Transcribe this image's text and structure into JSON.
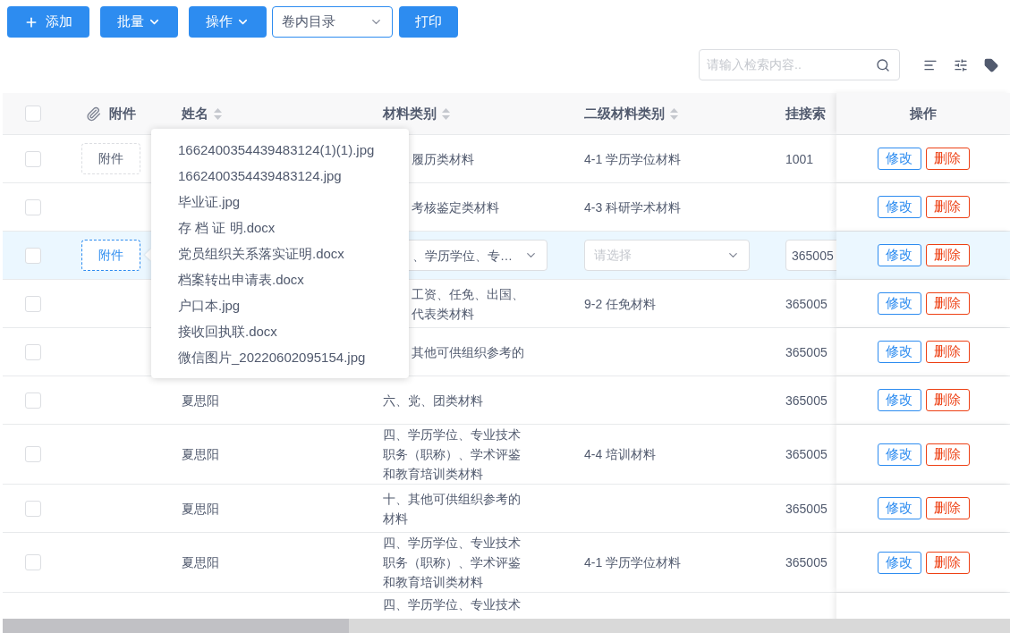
{
  "toolbar": {
    "buttons": [
      {
        "kind": "add",
        "label": "添加"
      },
      {
        "kind": "dropdown",
        "label": "批量"
      },
      {
        "kind": "dropdown",
        "label": "操作"
      },
      {
        "kind": "select",
        "label": "卷内目录"
      },
      {
        "kind": "plain",
        "label": "打印"
      }
    ]
  },
  "search": {
    "placeholder": "请输入检索内容.."
  },
  "table": {
    "header_checked": false,
    "columns": [
      {
        "kind": "attachment",
        "label": "附件"
      },
      {
        "kind": "sortable",
        "label": "姓名"
      },
      {
        "kind": "sortable",
        "label": "材料类别"
      },
      {
        "kind": "sortable",
        "label": "二级材料类别"
      },
      {
        "kind": "plain",
        "label": "挂接索"
      }
    ],
    "action_header": "操作",
    "rows": [
      {
        "kind": "view",
        "selected": false,
        "checked": false,
        "attachment": {
          "label": "附件",
          "active": false
        },
        "material": "履历类材料",
        "secondary": "4-1 学历学位材料",
        "index": "1001",
        "actions": [
          {
            "kind": "edit",
            "label": "修改"
          },
          {
            "kind": "delete",
            "label": "删除"
          }
        ]
      },
      {
        "kind": "view",
        "selected": false,
        "checked": false,
        "material": "考核鉴定类材料",
        "secondary": "4-3 科研学术材料",
        "actions": [
          {
            "kind": "edit",
            "label": "修改"
          },
          {
            "kind": "delete",
            "label": "删除"
          }
        ]
      },
      {
        "kind": "edit",
        "selected": true,
        "checked": false,
        "attachment": {
          "label": "附件",
          "active": true
        },
        "material": "、学历学位、专…",
        "secondary_placeholder": "请选择",
        "index": "365005",
        "actions": [
          {
            "kind": "edit",
            "label": "修改"
          },
          {
            "kind": "delete",
            "label": "删除"
          }
        ]
      },
      {
        "kind": "view",
        "selected": false,
        "checked": false,
        "material": "工资、任免、出国、代表类材料",
        "secondary": "9-2 任免材料",
        "index": "365005",
        "actions": [
          {
            "kind": "edit",
            "label": "修改"
          },
          {
            "kind": "delete",
            "label": "删除"
          }
        ]
      },
      {
        "kind": "view",
        "selected": false,
        "checked": false,
        "material": "其他可供组织参考的",
        "index": "365005",
        "actions": [
          {
            "kind": "edit",
            "label": "修改"
          },
          {
            "kind": "delete",
            "label": "删除"
          }
        ]
      },
      {
        "kind": "view",
        "selected": false,
        "checked": false,
        "name": "夏思阳",
        "material": "六、党、团类材料",
        "index": "365005",
        "actions": [
          {
            "kind": "edit",
            "label": "修改"
          },
          {
            "kind": "delete",
            "label": "删除"
          }
        ]
      },
      {
        "kind": "view",
        "selected": false,
        "checked": false,
        "name": "夏思阳",
        "material": "四、学历学位、专业技术职务（职称）、学术评鉴和教育培训类材料",
        "secondary": "4-4 培训材料",
        "index": "365005",
        "actions": [
          {
            "kind": "edit",
            "label": "修改"
          },
          {
            "kind": "delete",
            "label": "删除"
          }
        ]
      },
      {
        "kind": "view",
        "selected": false,
        "checked": false,
        "name": "夏思阳",
        "material": "十、其他可供组织参考的材料",
        "index": "365005",
        "actions": [
          {
            "kind": "edit",
            "label": "修改"
          },
          {
            "kind": "delete",
            "label": "删除"
          }
        ]
      },
      {
        "kind": "view",
        "selected": false,
        "checked": false,
        "name": "夏思阳",
        "material": "四、学历学位、专业技术职务（职称）、学术评鉴和教育培训类材料",
        "secondary": "4-1 学历学位材料",
        "index": "365005",
        "actions": [
          {
            "kind": "edit",
            "label": "修改"
          },
          {
            "kind": "delete",
            "label": "删除"
          }
        ]
      },
      {
        "kind": "partial",
        "material": "四、学历学位、专业技术"
      }
    ]
  },
  "popover": {
    "items": [
      "1662400354439483124(1)(1).jpg",
      "1662400354439483124.jpg",
      "毕业证.jpg",
      "存 档 证 明.docx",
      "党员组织关系落实证明.docx",
      "档案转出申请表.docx",
      "户口本.jpg",
      "接收回执联.docx",
      "微信图片_20220602095154.jpg"
    ]
  }
}
